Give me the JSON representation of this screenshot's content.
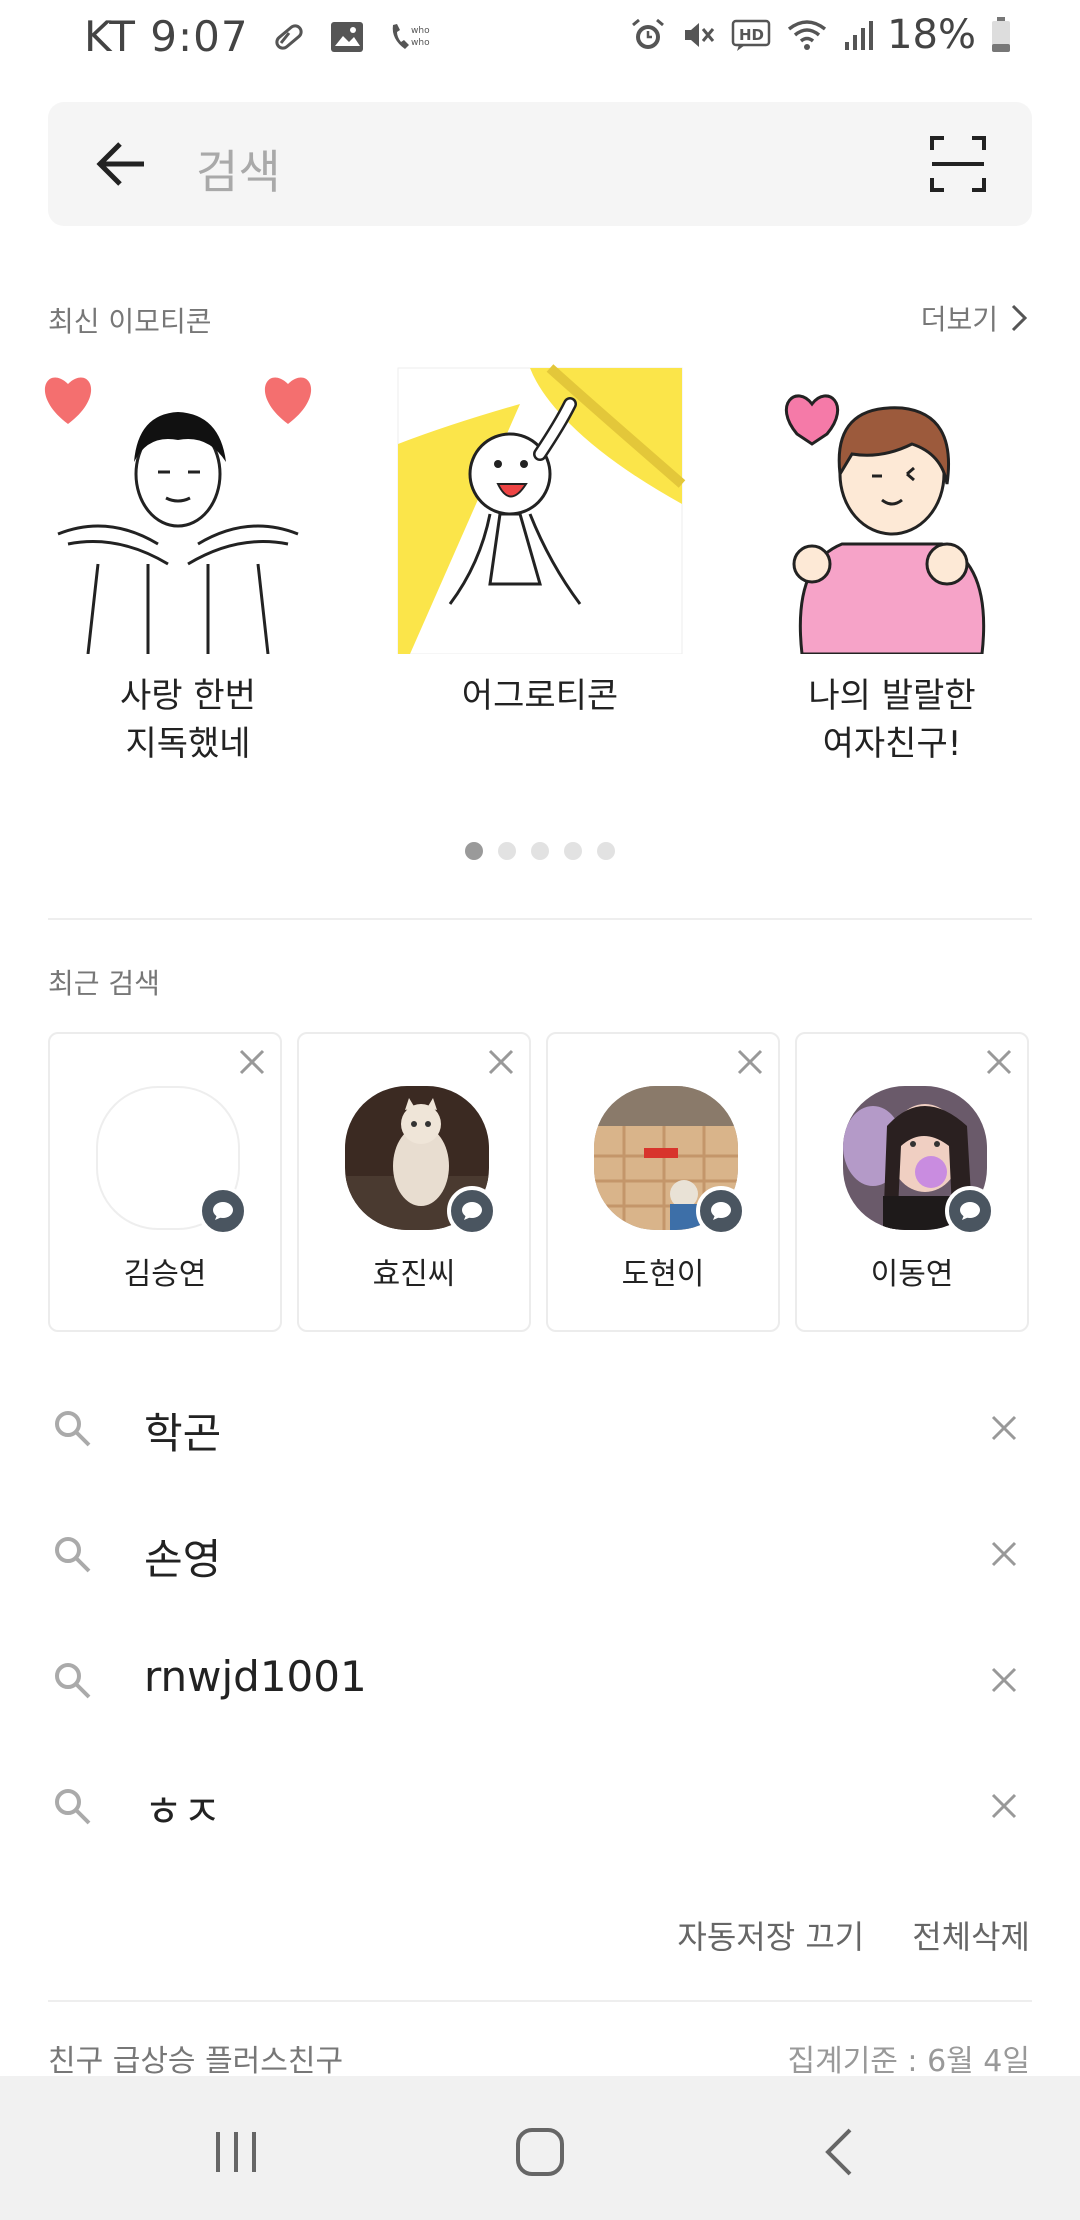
{
  "status_bar": {
    "carrier": "KT",
    "time": "9:07",
    "battery": "18%"
  },
  "search": {
    "placeholder": "검색"
  },
  "emoticons": {
    "title": "최신 이모티콘",
    "more": "더보기",
    "items": [
      {
        "label": "사랑 한번\n지독했네"
      },
      {
        "label": "어그로티콘"
      },
      {
        "label": "나의 발랄한\n여자친구!"
      }
    ],
    "page_count": 5,
    "current_page": 1
  },
  "recent_search": {
    "title": "최근 검색",
    "friends": [
      {
        "name": "김승연"
      },
      {
        "name": "효진씨"
      },
      {
        "name": "도현이"
      },
      {
        "name": "이동연"
      }
    ],
    "keywords": [
      "학곤",
      "손영",
      "rnwjd1001",
      "ㅎㅈ"
    ],
    "auto_save_off": "자동저장 끄기",
    "delete_all": "전체삭제"
  },
  "trending": {
    "title": "친구 급상승 플러스친구",
    "date_label": "집계기준 : 6월 4일"
  },
  "colors": {
    "search_bg": "#f5f5f5",
    "badge": "#4a5560",
    "nav_bg": "#f1f1f1"
  }
}
